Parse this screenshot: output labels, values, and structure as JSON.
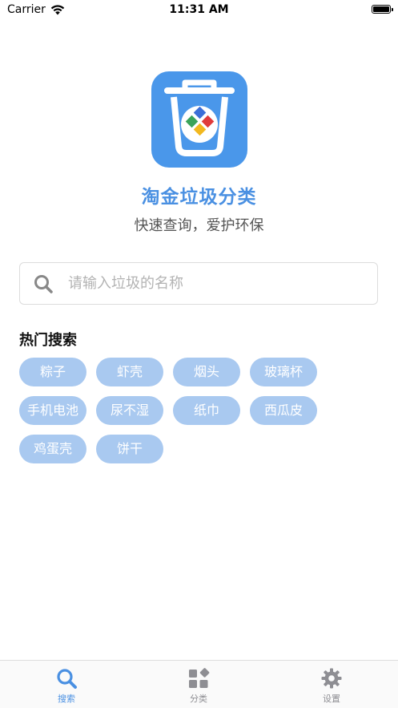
{
  "status_bar": {
    "carrier": "Carrier",
    "time": "11:31 AM"
  },
  "app": {
    "title": "淘金垃圾分类",
    "subtitle": "快速查询，爱护环保",
    "accent_color": "#4a90e2"
  },
  "search": {
    "placeholder": "请输入垃圾的名称",
    "value": ""
  },
  "hot_search": {
    "title": "热门搜索",
    "tags": [
      "粽子",
      "虾壳",
      "烟头",
      "玻璃杯",
      "手机电池",
      "尿不湿",
      "纸巾",
      "西瓜皮",
      "鸡蛋壳",
      "饼干"
    ]
  },
  "tab_bar": {
    "tabs": [
      {
        "label": "搜索",
        "icon": "search-icon",
        "active": true
      },
      {
        "label": "分类",
        "icon": "grid-icon",
        "active": false
      },
      {
        "label": "设置",
        "icon": "gear-icon",
        "active": false
      }
    ]
  }
}
